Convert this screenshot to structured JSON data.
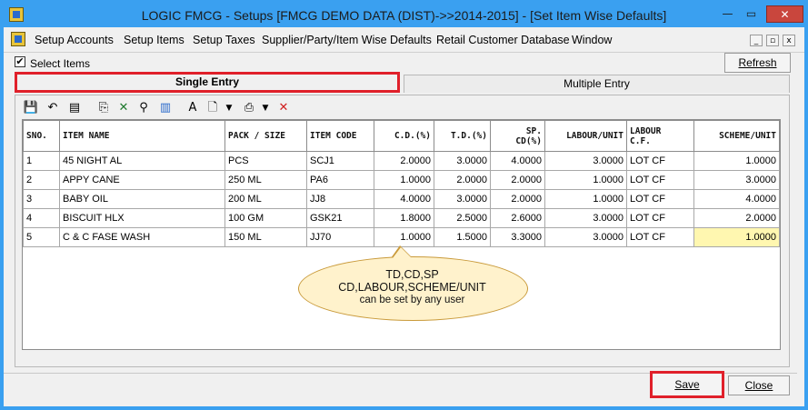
{
  "window": {
    "title": "LOGIC FMCG - Setups  [FMCG DEMO DATA (DIST)->>2014-2015] - [Set Item Wise Defaults]",
    "minimize": "—",
    "maximize": "▭",
    "close": "✕"
  },
  "menu": {
    "items": [
      "Setup Accounts",
      "Setup Items",
      "Setup Taxes",
      "Supplier/Party/Item Wise Defaults",
      "Retail Customer Database",
      "Window"
    ],
    "mdi_minimize": "_",
    "mdi_restore": "▫",
    "mdi_close": "x"
  },
  "options": {
    "select_items_label": "Select Items",
    "select_items_checked": "✔",
    "refresh_label": "Refresh"
  },
  "tabs": {
    "single": "Single Entry",
    "multiple": "Multiple Entry"
  },
  "toolbar": {
    "icons": [
      "save-icon",
      "undo-icon",
      "export-icon",
      "copy-icon",
      "excel-icon",
      "find-icon",
      "chart-icon",
      "font-icon",
      "print-preview-icon",
      "dropdown-icon",
      "print-icon",
      "dropdown-icon",
      "delete-icon"
    ]
  },
  "grid": {
    "columns": [
      "SNO.",
      "ITEM NAME",
      "PACK / SIZE",
      "ITEM CODE",
      "C.D.(%)",
      "T.D.(%)",
      "SP.\nCD(%)",
      "LABOUR/UNIT",
      "LABOUR\nC.F.",
      "SCHEME/UNIT"
    ],
    "rows": [
      [
        "1",
        "45 NIGHT AL",
        "PCS",
        "SCJ1",
        "2.0000",
        "3.0000",
        "4.0000",
        "3.0000",
        "LOT CF",
        "1.0000"
      ],
      [
        "2",
        "APPY CANE",
        "250 ML",
        "PA6",
        "1.0000",
        "2.0000",
        "2.0000",
        "1.0000",
        "LOT CF",
        "3.0000"
      ],
      [
        "3",
        "BABY OIL",
        "200 ML",
        "JJ8",
        "4.0000",
        "3.0000",
        "2.0000",
        "1.0000",
        "LOT CF",
        "4.0000"
      ],
      [
        "4",
        "BISCUIT HLX",
        "100 GM",
        "GSK21",
        "1.8000",
        "2.5000",
        "2.6000",
        "3.0000",
        "LOT CF",
        "2.0000"
      ],
      [
        "5",
        "C & C FASE WASH",
        "150 ML",
        "JJ70",
        "1.0000",
        "1.5000",
        "3.3000",
        "3.0000",
        "LOT CF",
        "1.0000"
      ]
    ]
  },
  "callout": {
    "line1": "TD,CD,SP",
    "line2": "CD,LABOUR,SCHEME/UNIT",
    "line3": "can be set by any user"
  },
  "buttons": {
    "save": "Save",
    "close": "Close"
  },
  "colors": {
    "title_bar": "#3aa0f0",
    "highlight_box": "#e0202a",
    "selected_cell": "#fff7b0",
    "callout_fill": "#fff2cc"
  }
}
